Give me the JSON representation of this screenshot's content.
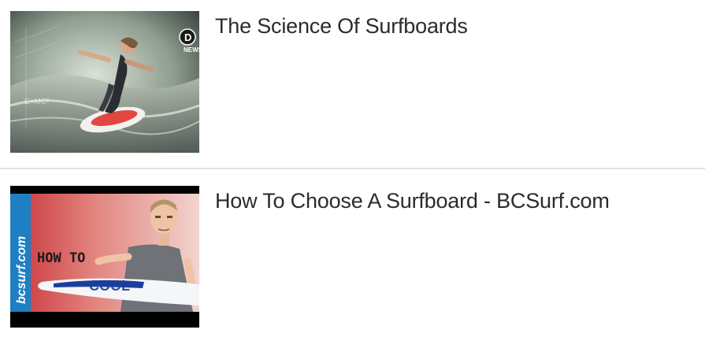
{
  "results": [
    {
      "title": "The Science Of Surfboards",
      "thumbnail": {
        "description": "surfer riding a red and white surfboard on a wave",
        "logo_text": "D",
        "badge_text": "NEWS",
        "overlay_text": "E=MC²"
      }
    },
    {
      "title": "How To Choose A Surfboard - BCSurf.com",
      "thumbnail": {
        "description": "man holding a blue and white surfboard",
        "side_text": "bcsurf.com",
        "overlay_text": "HOW TO",
        "board_text": "COOL"
      }
    }
  ],
  "colors": {
    "title": "#2b2b2b",
    "divider": "#e2e2e2",
    "thumb1_bg": "#8a9a8c",
    "thumb2_bg": "#d94a4a",
    "bcsurf_blue": "#1f7fc4"
  }
}
